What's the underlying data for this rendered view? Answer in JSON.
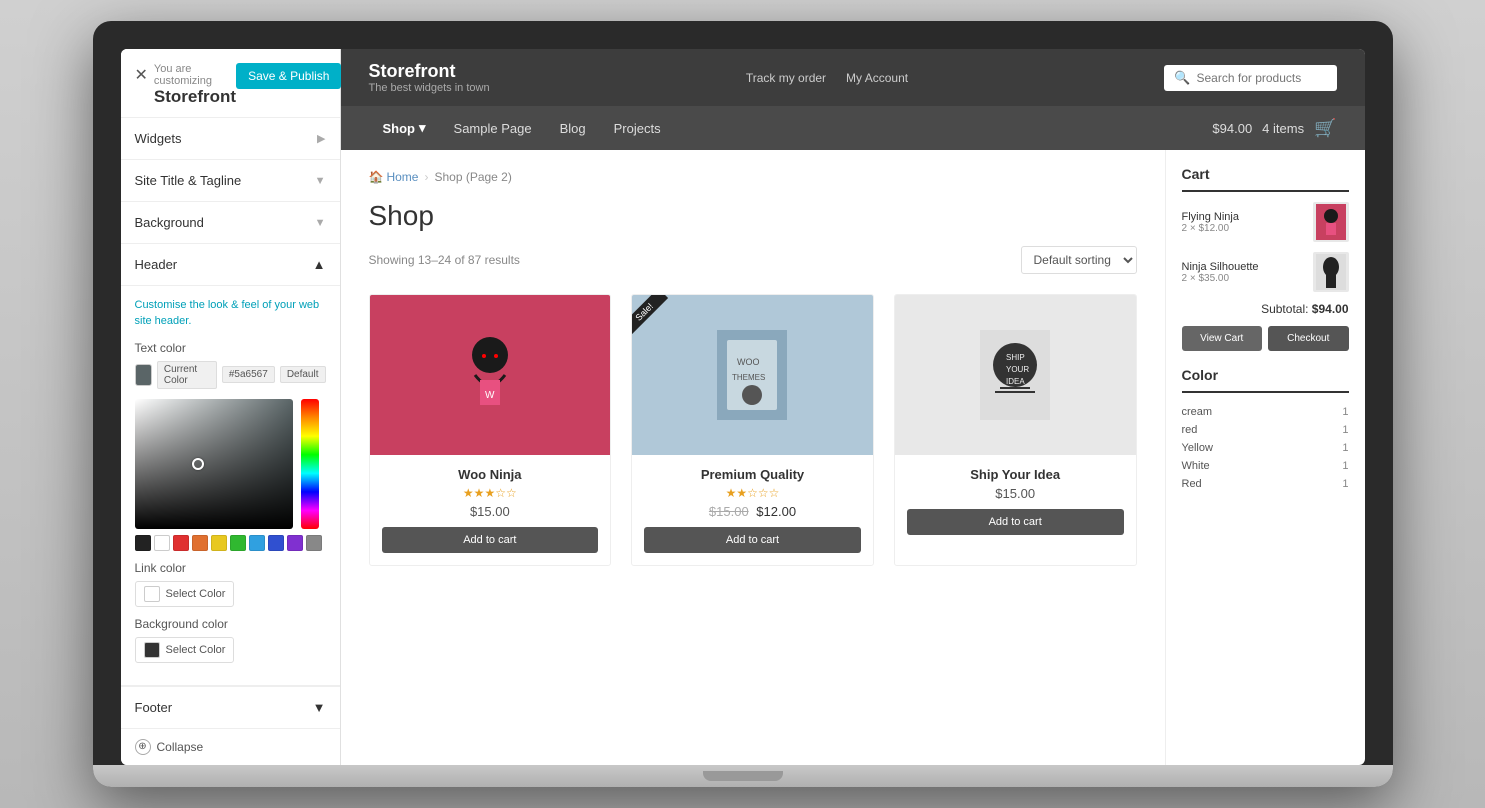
{
  "laptop": {
    "panel": {
      "close_label": "✕",
      "save_publish": "Save & Publish",
      "customizing": "You are customizing",
      "storefront": "Storefront",
      "widgets": "Widgets",
      "site_title": "Site Title & Tagline",
      "background": "Background",
      "header": "Header",
      "header_desc": "Customise the look & feel of your web site header.",
      "text_color_label": "Text color",
      "current_color": "Current Color",
      "hex_value": "#5a6567",
      "default_label": "Default",
      "link_color_label": "Link color",
      "select_color": "Select Color",
      "bg_color_label": "Background color",
      "footer_label": "Footer",
      "collapse_label": "Collapse"
    },
    "store": {
      "brand_title": "Storefront",
      "brand_sub": "The best widgets in town",
      "nav_track": "Track my order",
      "nav_account": "My Account",
      "search_placeholder": "Search for products",
      "nav_shop": "Shop",
      "nav_sample": "Sample Page",
      "nav_blog": "Blog",
      "nav_projects": "Projects",
      "cart_price": "$94.00",
      "cart_items": "4 items",
      "breadcrumb_home": "Home",
      "breadcrumb_shop": "Shop (Page 2)",
      "shop_title": "Shop",
      "showing": "Showing 13–24 of 87 results",
      "sort_default": "Default sorting",
      "products": [
        {
          "name": "Woo Ninja",
          "stars": "★★★☆☆",
          "price": "$15.00",
          "original_price": null,
          "sale_price": null,
          "on_sale": false,
          "btn": "Add to cart",
          "color": "#d4566a"
        },
        {
          "name": "Premium Quality",
          "stars": "★★☆☆☆",
          "price": "$12.00",
          "original_price": "$15.00",
          "sale_price": "$12.00",
          "on_sale": true,
          "btn": "Add to cart",
          "color": "#a0b8c8"
        },
        {
          "name": "Ship Your Idea",
          "stars": "",
          "price": "$15.00",
          "original_price": null,
          "sale_price": null,
          "on_sale": false,
          "btn": "Add to cart",
          "color": "#e0e0e0"
        }
      ],
      "cart_title": "Cart",
      "cart_items_list": [
        {
          "name": "Flying Ninja",
          "qty": "2 × $12.00"
        },
        {
          "name": "Ninja Silhouette",
          "qty": "2 × $35.00"
        }
      ],
      "subtotal_label": "Subtotal:",
      "subtotal_value": "$94.00",
      "view_cart": "View Cart",
      "checkout": "Checkout",
      "color_filter_title": "Color",
      "colors": [
        {
          "name": "cream",
          "count": 1
        },
        {
          "name": "red",
          "count": 1
        },
        {
          "name": "Yellow",
          "count": 1
        },
        {
          "name": "White",
          "count": 1
        },
        {
          "name": "Red",
          "count": 1
        }
      ]
    }
  },
  "swatches": [
    "#222",
    "#fff",
    "#e03030",
    "#e07030",
    "#e8c820",
    "#30b830",
    "#30a0e0",
    "#3050d0",
    "#8030d0"
  ],
  "hue_arrow": "▼"
}
